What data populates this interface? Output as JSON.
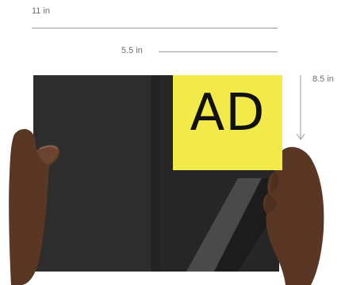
{
  "dimensions": {
    "width_label": "11 in",
    "half_width_label": "5.5 in",
    "height_label": "8.5 in"
  },
  "ad": {
    "label": "AD",
    "color": "#f2ea4a"
  },
  "colors": {
    "booklet": "#2b2b2b",
    "skin": "#5a3724",
    "dimension_line": "#9a9a9a"
  }
}
